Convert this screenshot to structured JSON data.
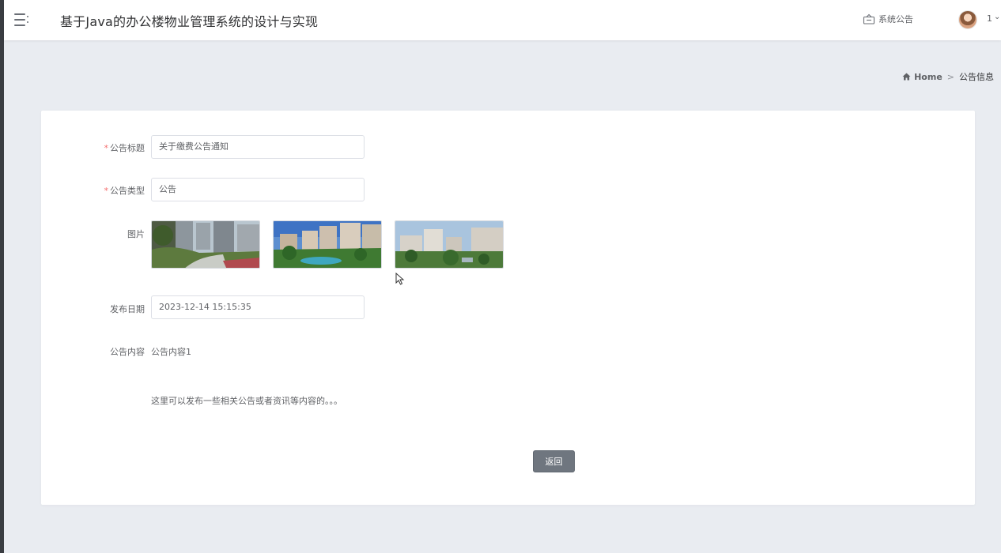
{
  "header": {
    "title": "基于Java的办公楼物业管理系统的设计与实现",
    "notice_label": "系统公告",
    "user_name": "1",
    "user_caret": "⌄"
  },
  "breadcrumb": {
    "home_label": "Home",
    "separator": ">",
    "current": "公告信息"
  },
  "form": {
    "title_label": "公告标题",
    "title_value": "关于缴费公告通知",
    "type_label": "公告类型",
    "type_value": "公告",
    "images_label": "图片",
    "date_label": "发布日期",
    "date_value": "2023-12-14 15:15:35",
    "content_label": "公告内容",
    "content_line1": "公告内容1",
    "content_line2": "这里可以发布一些相关公告或者资讯等内容的。。。",
    "required_mark": "*",
    "back_button": "返回"
  },
  "icons": {
    "menu": "hamburger-icon",
    "notice": "notice-icon",
    "home": "home-icon"
  },
  "colors": {
    "button_bg": "#6f767f",
    "page_bg": "#e9ecf1",
    "required": "#f56c6c"
  }
}
